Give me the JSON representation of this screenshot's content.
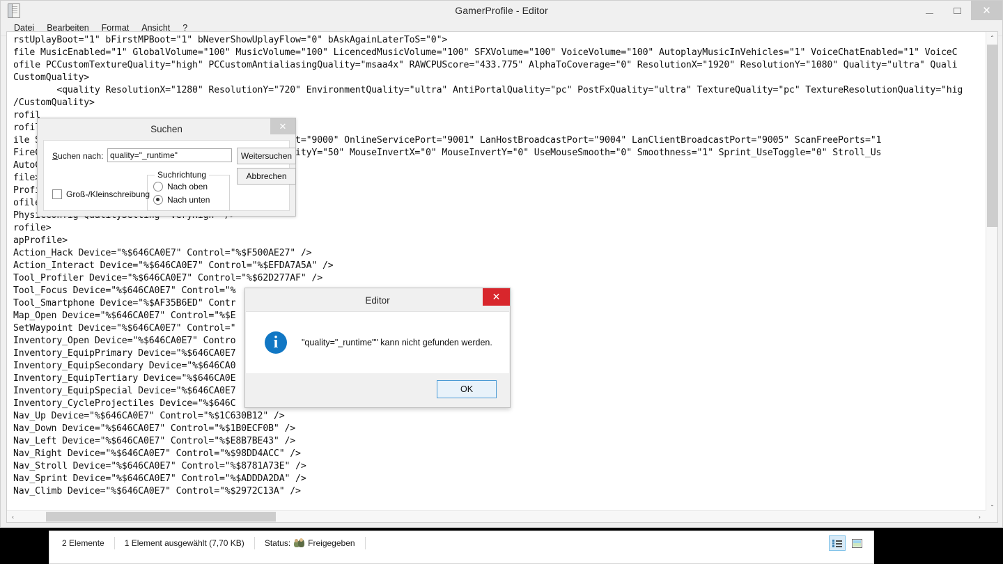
{
  "window": {
    "title": "GamerProfile - Editor",
    "icon": "notepad-icon",
    "minimize": "–",
    "maximize": "□",
    "close": "✕"
  },
  "menu": {
    "items": [
      {
        "label": "Datei"
      },
      {
        "label": "Bearbeiten"
      },
      {
        "label": "Format"
      },
      {
        "label": "Ansicht"
      },
      {
        "label": "?"
      }
    ]
  },
  "editor": {
    "content": "rstUplayBoot=\"1\" bFirstMPBoot=\"1\" bNeverShowUplayFlow=\"0\" bAskAgainLaterToS=\"0\">\nfile MusicEnabled=\"1\" GlobalVolume=\"100\" MusicVolume=\"100\" LicencedMusicVolume=\"100\" SFXVolume=\"100\" VoiceVolume=\"100\" AutoplayMusicInVehicles=\"1\" VoiceChatEnabled=\"1\" VoiceC\nofile PCCustomTextureQuality=\"high\" PCCustomAntialiasingQuality=\"msaa4x\" RAWCPUScore=\"433.775\" AlphaToCoverage=\"0\" ResolutionX=\"1920\" ResolutionY=\"1080\" Quality=\"ultra\" Quali\nCustomQuality>\n        <quality ResolutionX=\"1280\" ResolutionY=\"720\" EnvironmentQuality=\"ultra\" AntiPortalQuality=\"pc\" PostFxQuality=\"ultra\" TextureQuality=\"pc\" TextureResolutionQuality=\"hig\n/CustomQuality>\nrofil\nrofil\nile S                                OnlineEnginePort=\"9000\" OnlineServicePort=\"9001\" LanHostBroadcastPort=\"9004\" LanClientBroadcastPort=\"9005\" ScanFreePorts=\"1\nFireC                                useLookSensitivityY=\"50\" MouseInvertX=\"0\" MouseInvertY=\"0\" UseMouseSmooth=\"0\" Smoothness=\"1\" Sprint_UseToggle=\"0\" Stroll_Us\nAutoC\nfile>\nProfi\nofile\nPhysicConfig QualitySetting=\"VeryHigh\" />\nrofile>\napProfile>\nAction_Hack Device=\"%$646CA0E7\" Control=\"%$F500AE27\" />\nAction_Interact Device=\"%$646CA0E7\" Control=\"%$EFDA7A5A\" />\nTool_Profiler Device=\"%$646CA0E7\" Control=\"%$62D277AF\" />\nTool_Focus Device=\"%$646CA0E7\" Control=\"%\nTool_Smartphone Device=\"%$AF35B6ED\" Contr\nMap_Open Device=\"%$646CA0E7\" Control=\"%$E\nSetWaypoint Device=\"%$646CA0E7\" Control=\"\nInventory_Open Device=\"%$646CA0E7\" Contro\nInventory_EquipPrimary Device=\"%$646CA0E7\nInventory_EquipSecondary Device=\"%$646CA0\nInventory_EquipTertiary Device=\"%$646CA0E\nInventory_EquipSpecial Device=\"%$646CA0E7\nInventory_CycleProjectiles Device=\"%$646C\nNav_Up Device=\"%$646CA0E7\" Control=\"%$1C630B12\" />\nNav_Down Device=\"%$646CA0E7\" Control=\"%$1B0ECF0B\" />\nNav_Left Device=\"%$646CA0E7\" Control=\"%$E8B7BE43\" />\nNav_Right Device=\"%$646CA0E7\" Control=\"%$98DD4ACC\" />\nNav_Stroll Device=\"%$646CA0E7\" Control=\"%$8781A73E\" />\nNav_Sprint Device=\"%$646CA0E7\" Control=\"%$ADDDA2DA\" />\nNav_Climb Device=\"%$646CA0E7\" Control=\"%$2972C13A\" />"
  },
  "find_dialog": {
    "title": "Suchen",
    "close": "✕",
    "search_label_prefix": "S",
    "search_label_rest": "uchen nach:",
    "search_value": "quality=\"_runtime\"",
    "search_placeholder": "",
    "find_next_button": "Weitersuchen",
    "cancel_button": "Abbrechen",
    "match_case_label": "Groß-/Kleinschreibung",
    "match_case_checked": false,
    "direction_group_label": "Suchrichtung",
    "direction_up_label": "Nach oben",
    "direction_down_label": "Nach unten",
    "direction_selected": "down"
  },
  "message_box": {
    "title": "Editor",
    "close": "✕",
    "icon": "info-icon",
    "icon_glyph": "i",
    "message": "\"quality=\"_runtime\"\" kann nicht gefunden werden.",
    "ok_button": "OK"
  },
  "explorer_status": {
    "item_count": "2 Elemente",
    "selection": "1 Element ausgewählt (7,70 KB)",
    "status_label": "Status:",
    "status_value": "Freigegeben",
    "view_details_icon": "details-view-icon",
    "view_tiles_icon": "tiles-view-icon"
  },
  "scrollbars": {
    "up_arrow": "⌃",
    "down_arrow": "⌄",
    "left_arrow": "‹",
    "right_arrow": "›"
  },
  "colors": {
    "desktop": "#000000",
    "window_chrome": "#f0f0f0",
    "msgbox_close_red": "#d8262c",
    "info_blue": "#1177c4",
    "ok_border_blue": "#4a9ad4"
  }
}
